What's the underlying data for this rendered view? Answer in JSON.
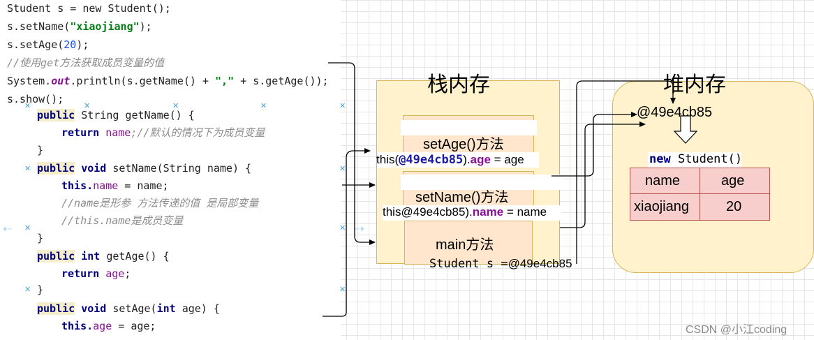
{
  "code": {
    "line1": "Student s = new Student();",
    "line2_pre": "s.setName(",
    "line2_str": "\"xiaojiang\"",
    "line2_post": ");",
    "line3_pre": "s.setAge(",
    "line3_num": "20",
    "line3_post": ");",
    "line4_comment": "//使用get方法获取成员变量的值",
    "line5_pre": "System.",
    "line5_out": "out",
    "line5_mid": ".println(s.getName() + ",
    "line5_str": "\",\"",
    "line5_post": " + s.getAge());",
    "line6": "s.show();",
    "getname_kw": "public",
    "getname_sig": " String getName() {",
    "getname_ret_kw": "return",
    "getname_ret_field": "name",
    "getname_ret_comment": ";//默认的情况下为成员变量",
    "close": "}",
    "setname_kw": "public",
    "setname_void": "void",
    "setname_sig": " setName(String name) {",
    "setname_this": "this.",
    "setname_field": "name",
    "setname_assign": " = name;",
    "setname_comment1": "//name是形参 方法传递的值 是局部变量",
    "setname_comment2": "//this.name是成员变量",
    "getage_kw": "public",
    "getage_int": "int",
    "getage_sig": " getAge() {",
    "getage_ret_kw": "return",
    "getage_ret_field": "age",
    "getage_semi": ";",
    "setage_kw": "public",
    "setage_void": "void",
    "setage_sig": " setAge(",
    "setage_int": "int",
    "setage_sig2": " age) {",
    "setage_this": "this.",
    "setage_field": "age",
    "setage_assign": " = age;"
  },
  "diagram": {
    "stack_title": "栈内存",
    "heap_title": "堆内存",
    "setage_frame": "setAge()方法",
    "setage_this_pre": "this(",
    "setage_this_addr": "@49e4cb85",
    "setage_this_mid": ").",
    "setage_this_field": "age",
    "setage_this_post": " = age",
    "setname_frame": "setName()方法",
    "setname_this_pre": "this@49e4cb85).",
    "setname_this_field": "name",
    "setname_this_post": " = name",
    "main_frame": "main方法",
    "main_var": "Student s =",
    "main_addr": "@49e4cb85",
    "heap_addr": "@49e4cb85",
    "new_kw": "new",
    "new_cls": " Student()",
    "table_headers": [
      "name",
      "age"
    ],
    "table_values": [
      "xiaojiang",
      "20"
    ]
  },
  "watermark": "CSDN @小江coding",
  "colors": {
    "frame_fill": "#fff2cc",
    "frame_border": "#d6b656",
    "table_fill": "#f8cecc",
    "table_border": "#b85450"
  }
}
